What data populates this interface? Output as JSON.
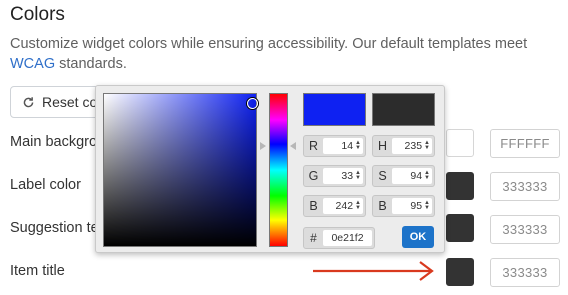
{
  "section": {
    "title": "Colors",
    "description_before": "Customize widget colors while ensuring accessibility. Our default templates meet ",
    "description_link": "WCAG",
    "description_after": " standards."
  },
  "reset_button": {
    "label": "Reset co",
    "icon": "refresh-icon"
  },
  "rows": [
    {
      "label": "Main backgro",
      "swatch_color": "#FFFFFF",
      "hex_value": "FFFFFF"
    },
    {
      "label": "Label color",
      "swatch_color": "#333333",
      "hex_value": "333333"
    },
    {
      "label": "Suggestion te",
      "swatch_color": "#333333",
      "hex_value": "333333"
    },
    {
      "label": "Item title",
      "swatch_color": "#333333",
      "hex_value": "333333"
    }
  ],
  "picker": {
    "new_color": "#0E21F2",
    "current_color": "#333333",
    "fields": {
      "r": {
        "label": "R",
        "value": "14"
      },
      "g": {
        "label": "G",
        "value": "33"
      },
      "b": {
        "label": "B",
        "value": "242"
      },
      "h": {
        "label": "H",
        "value": "235"
      },
      "s": {
        "label": "S",
        "value": "94"
      },
      "v": {
        "label": "B",
        "value": "95"
      }
    },
    "hex": {
      "label": "#",
      "value": "0e21f2"
    },
    "ok_label": "OK"
  },
  "annotation": {
    "arrow_color": "#D9391E"
  }
}
